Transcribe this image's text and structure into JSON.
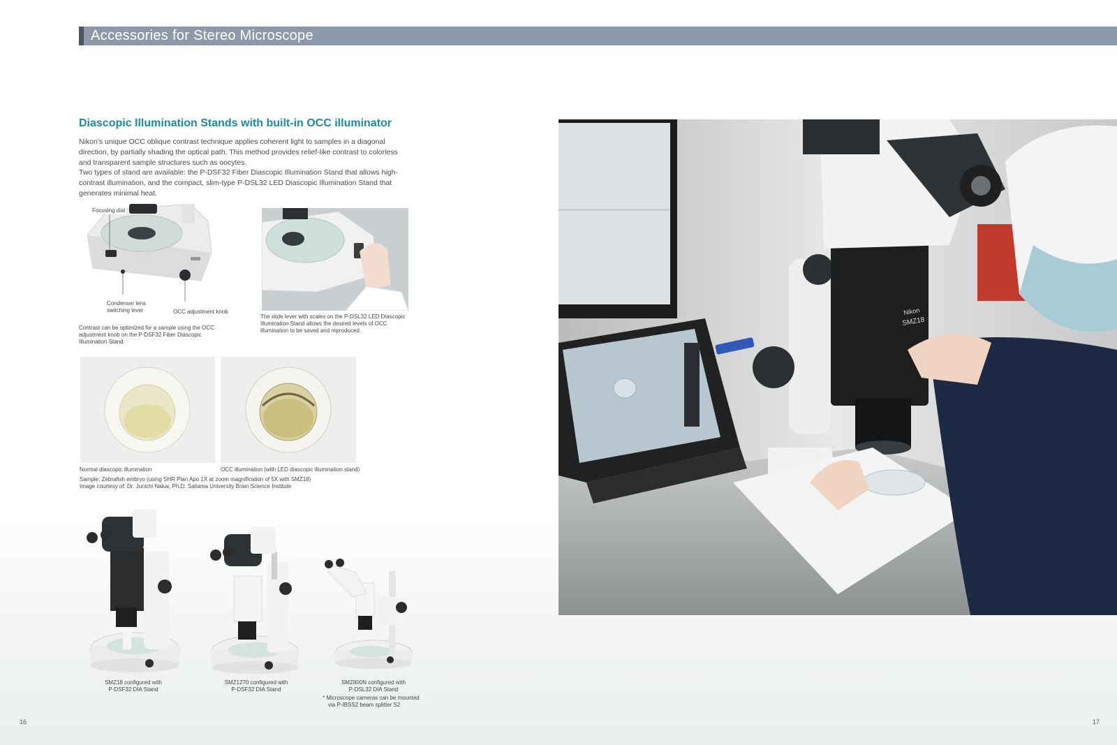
{
  "header": {
    "title": "Accessories for Stereo Microscope"
  },
  "section": {
    "heading": "Diascopic Illumination Stands with built-in OCC illuminator",
    "paragraph1": "Nikon's unique OCC oblique contrast technique applies coherent light to samples in a diagonal direction, by partially shading the optical path. This method provides relief-like contrast to colorless and transparent sample structures such as oocytes.",
    "paragraph2": "Two types of stand are available: the P-DSF32 Fiber Diascopic Illumination Stand that allows high-contrast illumination, and the compact, slim-type P-DSL32 LED Diascopic Illumination Stand that generates minimal heat."
  },
  "stand_figure": {
    "label_focusing": "Focusing dial",
    "label_condenser_line1": "Condenser lens",
    "label_condenser_line2": "switching lever",
    "label_occ": "OCC adjustment knob",
    "caption": "Contrast can be optimized for a sample using the OCC adjustment knob on the P-DSF32 Fiber Diascopic Illumination Stand."
  },
  "lever_figure": {
    "caption": "The slide lever with scales on the P-DSL32 LED Diascopic Illumination Stand allows the desired levels of OCC illumination to be saved and reproduced."
  },
  "embryo_figures": {
    "left_caption": "Normal diascopic illumination",
    "right_caption": "OCC illumination (with LED diascopic illumination stand)",
    "sample_line1": "Sample: Zebrafish embryo (using SHR Plan Apo 1X at zoom magnification of 5X with SMZ18)",
    "sample_line2": "Image courtesy of: Dr. Junichi Nakai, Ph.D. Saitama University Brain Science Institute"
  },
  "microscopes": [
    {
      "line1": "SMZ18 configured with",
      "line2": "P-DSF32 DIA Stand"
    },
    {
      "line1": "SMZ1270 configured with",
      "line2": "P-DSF32 DIA Stand"
    },
    {
      "line1": "SMZ800N configured with",
      "line2": "P-DSL32 DIA Stand"
    }
  ],
  "footnote": {
    "line1": "* Microscope cameras can be mounted",
    "line2": "via P-IBSS2 beam splitter S2"
  },
  "main_photo": {
    "scope_brand": "Nikon",
    "scope_model": "SMZ18"
  },
  "pages": {
    "left": "16",
    "right": "17"
  },
  "colors": {
    "accent_teal": "#1f8a9a",
    "header_bar": "#8d98a8"
  }
}
